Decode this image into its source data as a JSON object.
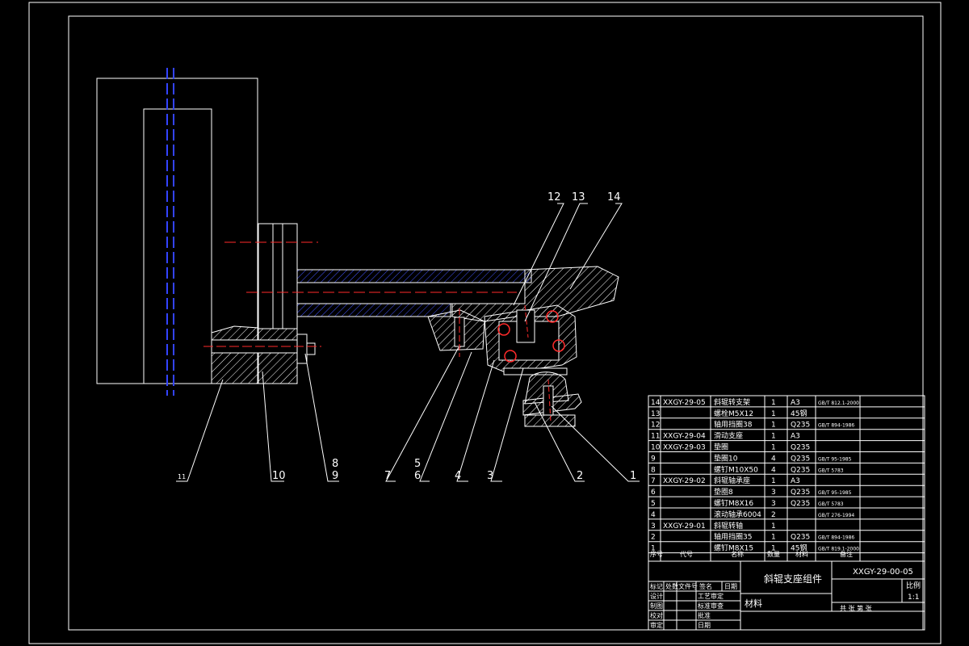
{
  "drawing": {
    "colors": {
      "background": "#000000",
      "outline": "#ffffff",
      "hatch": "#ffffff",
      "centerline": "#ff2a2a",
      "axis": "#3344ff",
      "section_hatch": "#4455ff"
    },
    "balloons": [
      "1",
      "2",
      "3",
      "4",
      "5",
      "6",
      "7",
      "8",
      "9",
      "10",
      "11",
      "12",
      "13",
      "14"
    ]
  },
  "parts_list": {
    "rows": [
      {
        "no": "14",
        "code": "XXGY-29-05",
        "name": "斜辊转支架",
        "qty": "1",
        "material": "A3",
        "standard": "GB/T 812.1-2000"
      },
      {
        "no": "13",
        "code": "",
        "name": "螺栓M5X12",
        "qty": "1",
        "material": "45钢",
        "standard": ""
      },
      {
        "no": "12",
        "code": "",
        "name": "轴用挡圈38",
        "qty": "1",
        "material": "Q235",
        "standard": "GB/T 894-1986"
      },
      {
        "no": "11",
        "code": "XXGY-29-04",
        "name": "滑动支座",
        "qty": "1",
        "material": "A3",
        "standard": ""
      },
      {
        "no": "10",
        "code": "XXGY-29-03",
        "name": "垫圈",
        "qty": "1",
        "material": "Q235",
        "standard": ""
      },
      {
        "no": "9",
        "code": "",
        "name": "垫圈10",
        "qty": "4",
        "material": "Q235",
        "standard": "GB/T 95-1985"
      },
      {
        "no": "8",
        "code": "",
        "name": "螺钉M10X50",
        "qty": "4",
        "material": "Q235",
        "standard": "GB/T 5783"
      },
      {
        "no": "7",
        "code": "XXGY-29-02",
        "name": "斜辊轴承座",
        "qty": "1",
        "material": "A3",
        "standard": ""
      },
      {
        "no": "6",
        "code": "",
        "name": "垫圈8",
        "qty": "3",
        "material": "Q235",
        "standard": "GB/T 95-1985"
      },
      {
        "no": "5",
        "code": "",
        "name": "螺钉M8X16",
        "qty": "3",
        "material": "Q235",
        "standard": "GB/T 5783"
      },
      {
        "no": "4",
        "code": "",
        "name": "滚动轴承6004",
        "qty": "2",
        "material": "",
        "standard": "GB/T 276-1994"
      },
      {
        "no": "3",
        "code": "XXGY-29-01",
        "name": "斜辊转轴",
        "qty": "1",
        "material": "",
        "standard": ""
      },
      {
        "no": "2",
        "code": "",
        "name": "轴用挡圈35",
        "qty": "1",
        "material": "Q235",
        "standard": "GB/T 894-1986"
      },
      {
        "no": "1",
        "code": "",
        "name": "螺钉M8X15",
        "qty": "1",
        "material": "45钢",
        "standard": "GB/T 819.1-2000"
      }
    ],
    "header": {
      "no": "序号",
      "code": "代号",
      "name": "名称",
      "qty": "数量",
      "material": "材料",
      "remark": "备注"
    }
  },
  "title_block": {
    "title": "斜辊支座组件",
    "drawing_no": "XXGY-29-00-05",
    "scale_label": "比例",
    "scale": "1:1",
    "material_label": "材料",
    "sheet": "共 张  第 张",
    "rev_header": [
      "标记",
      "处数",
      "文件号",
      "签名",
      "日期"
    ],
    "signoff_rows": [
      {
        "role": "设计",
        "approval": "工艺审定"
      },
      {
        "role": "制图",
        "approval": "标准审查"
      },
      {
        "role": "校对",
        "approval": "批准"
      },
      {
        "role": "审定",
        "approval": "日期"
      }
    ]
  }
}
